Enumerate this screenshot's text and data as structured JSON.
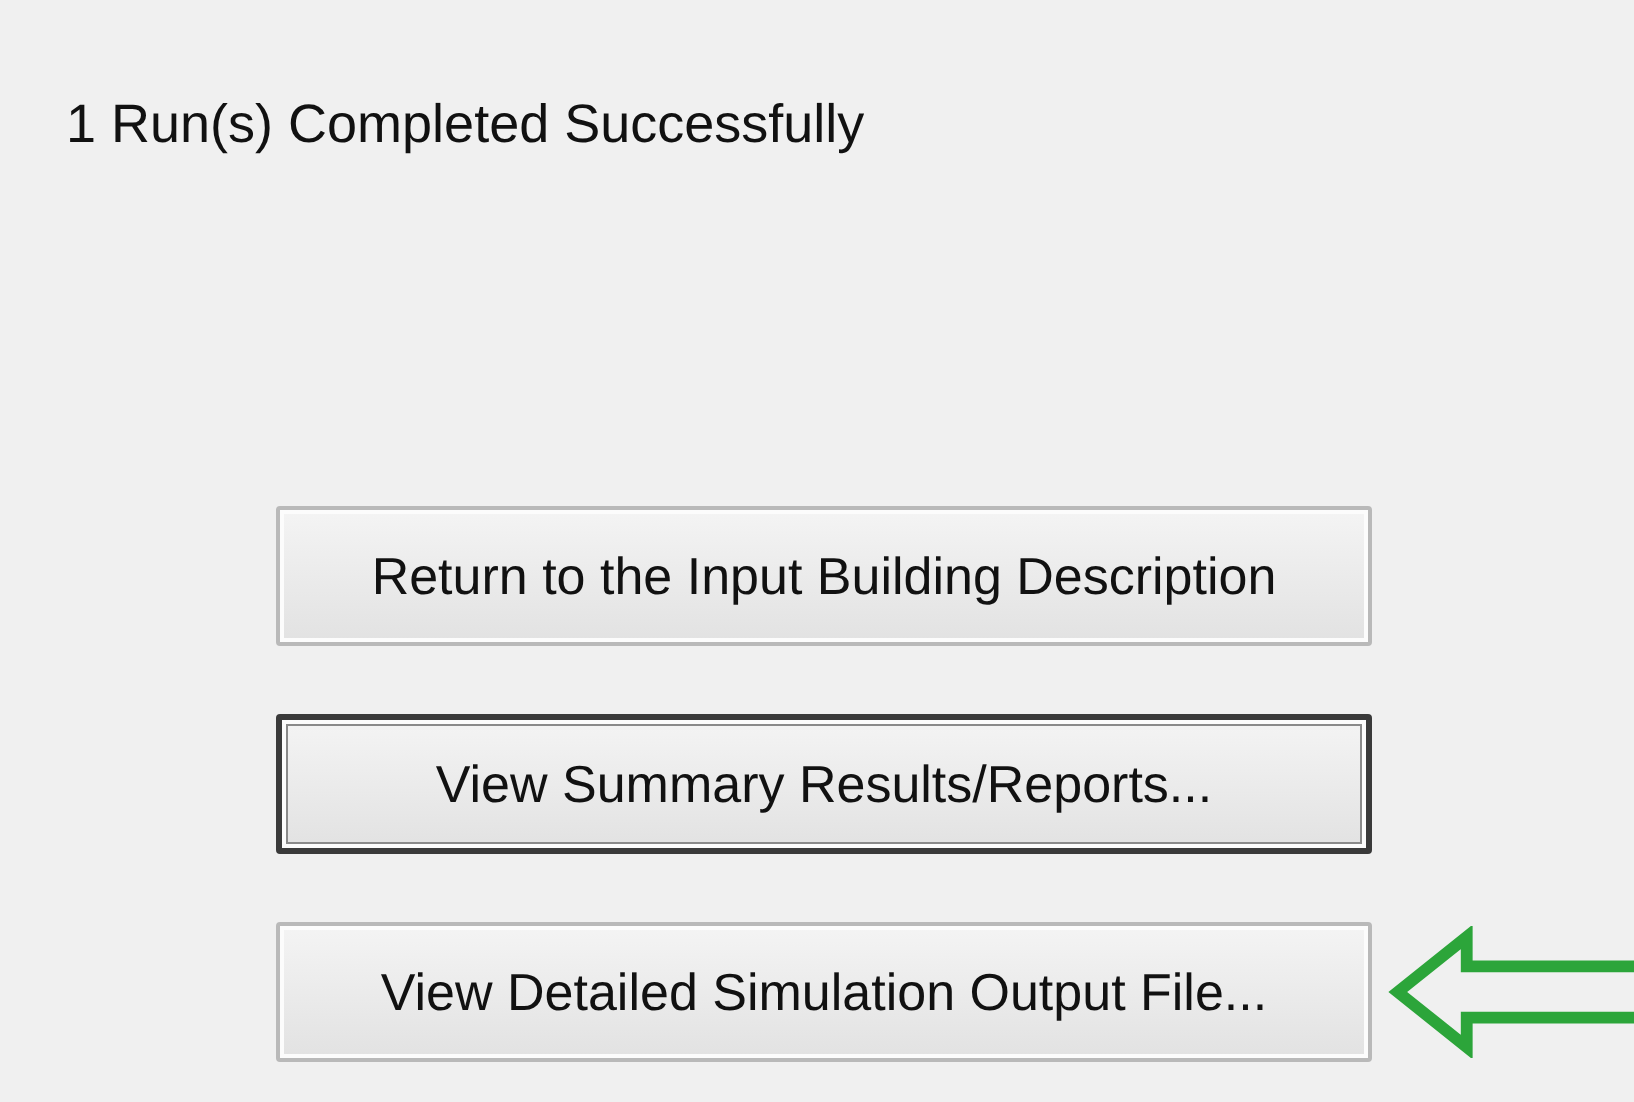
{
  "status": "1 Run(s) Completed Successfully",
  "buttons": [
    {
      "label": "Return to the Input Building Description",
      "default": false
    },
    {
      "label": "View Summary Results/Reports...",
      "default": true
    },
    {
      "label": "View Detailed Simulation Output File...",
      "default": false
    }
  ]
}
